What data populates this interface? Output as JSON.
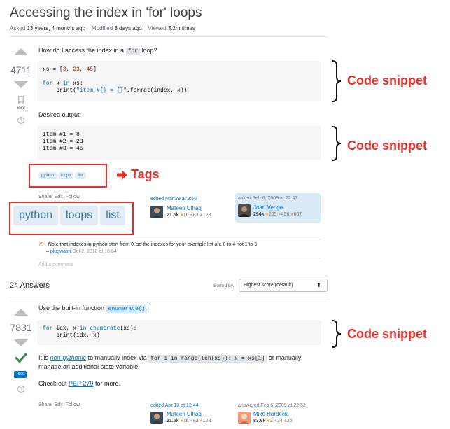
{
  "question": {
    "title": "Accessing the index in 'for' loops",
    "asked_label": "Asked",
    "asked_value": "13 years, 4 months ago",
    "modified_label": "Modified",
    "modified_value": "8 days ago",
    "viewed_label": "Viewed",
    "viewed_value": "3.2m times",
    "score": "4711",
    "bookmarks": "888",
    "body_prefix": "How do I access the index in a",
    "body_code": "for",
    "body_suffix": "loop?",
    "desired_output": "Desired output:",
    "tags": [
      "python",
      "loops",
      "list"
    ],
    "links": {
      "share": "Share",
      "edit": "Edit",
      "follow": "Follow"
    },
    "edited": {
      "label": "edited Mar 29 at 9:56",
      "user": "Mateen Ulhaq",
      "rep": "21.5k",
      "gold": "16",
      "silver": "83",
      "bronze": "123"
    },
    "asked_card": {
      "label": "asked Feb 6, 2009 at 22:47",
      "user": "Joan Venge",
      "rep": "294k",
      "gold": "205",
      "silver": "456",
      "bronze": "667"
    },
    "comment": {
      "score": "79",
      "text": "Note that indexes in python start from 0, so the indexes for your example list are 0 to 4 not 1 to 5",
      "user": "plugwash",
      "time": "Oct 2, 2018 at 16:54"
    },
    "add_comment": "Add a comment"
  },
  "answers": {
    "count_label": "24 Answers",
    "sort_label": "Sorted by:",
    "sort_value": "Highest score (default)"
  },
  "answer": {
    "score": "7831",
    "bounty": "+500",
    "intro": "Use the built-in function",
    "intro_code": "enumerate()",
    "p1_a": "It is",
    "p1_link": "non-pythonic",
    "p1_b": "to manually index via",
    "p1_code": "for i in range(len(xs)): x = xs[i]",
    "p1_c": "or manually",
    "p1_line2": "manage an additional state variable.",
    "p2_a": "Check out",
    "p2_link": "PEP 279",
    "p2_b": "for more.",
    "links": {
      "share": "Share",
      "edit": "Edit",
      "follow": "Follow"
    },
    "edited": {
      "label": "edited Apr 10 at 12:44",
      "user": "Mateen Ulhaq",
      "rep": "21.5k",
      "gold": "16",
      "silver": "83",
      "bronze": "123"
    },
    "answered": {
      "label": "answered Feb 6, 2009 at 22:52",
      "user": "Mike Hordecki",
      "rep": "83.6k",
      "gold": "3",
      "silver": "24",
      "bronze": "26"
    }
  },
  "annotations": {
    "code_snippet": "Code snippet",
    "tags": "Tags"
  },
  "colors": {
    "accent": "#0074cc",
    "annotation_red": "#e8302a",
    "tag_bg": "#e1ecf4"
  }
}
